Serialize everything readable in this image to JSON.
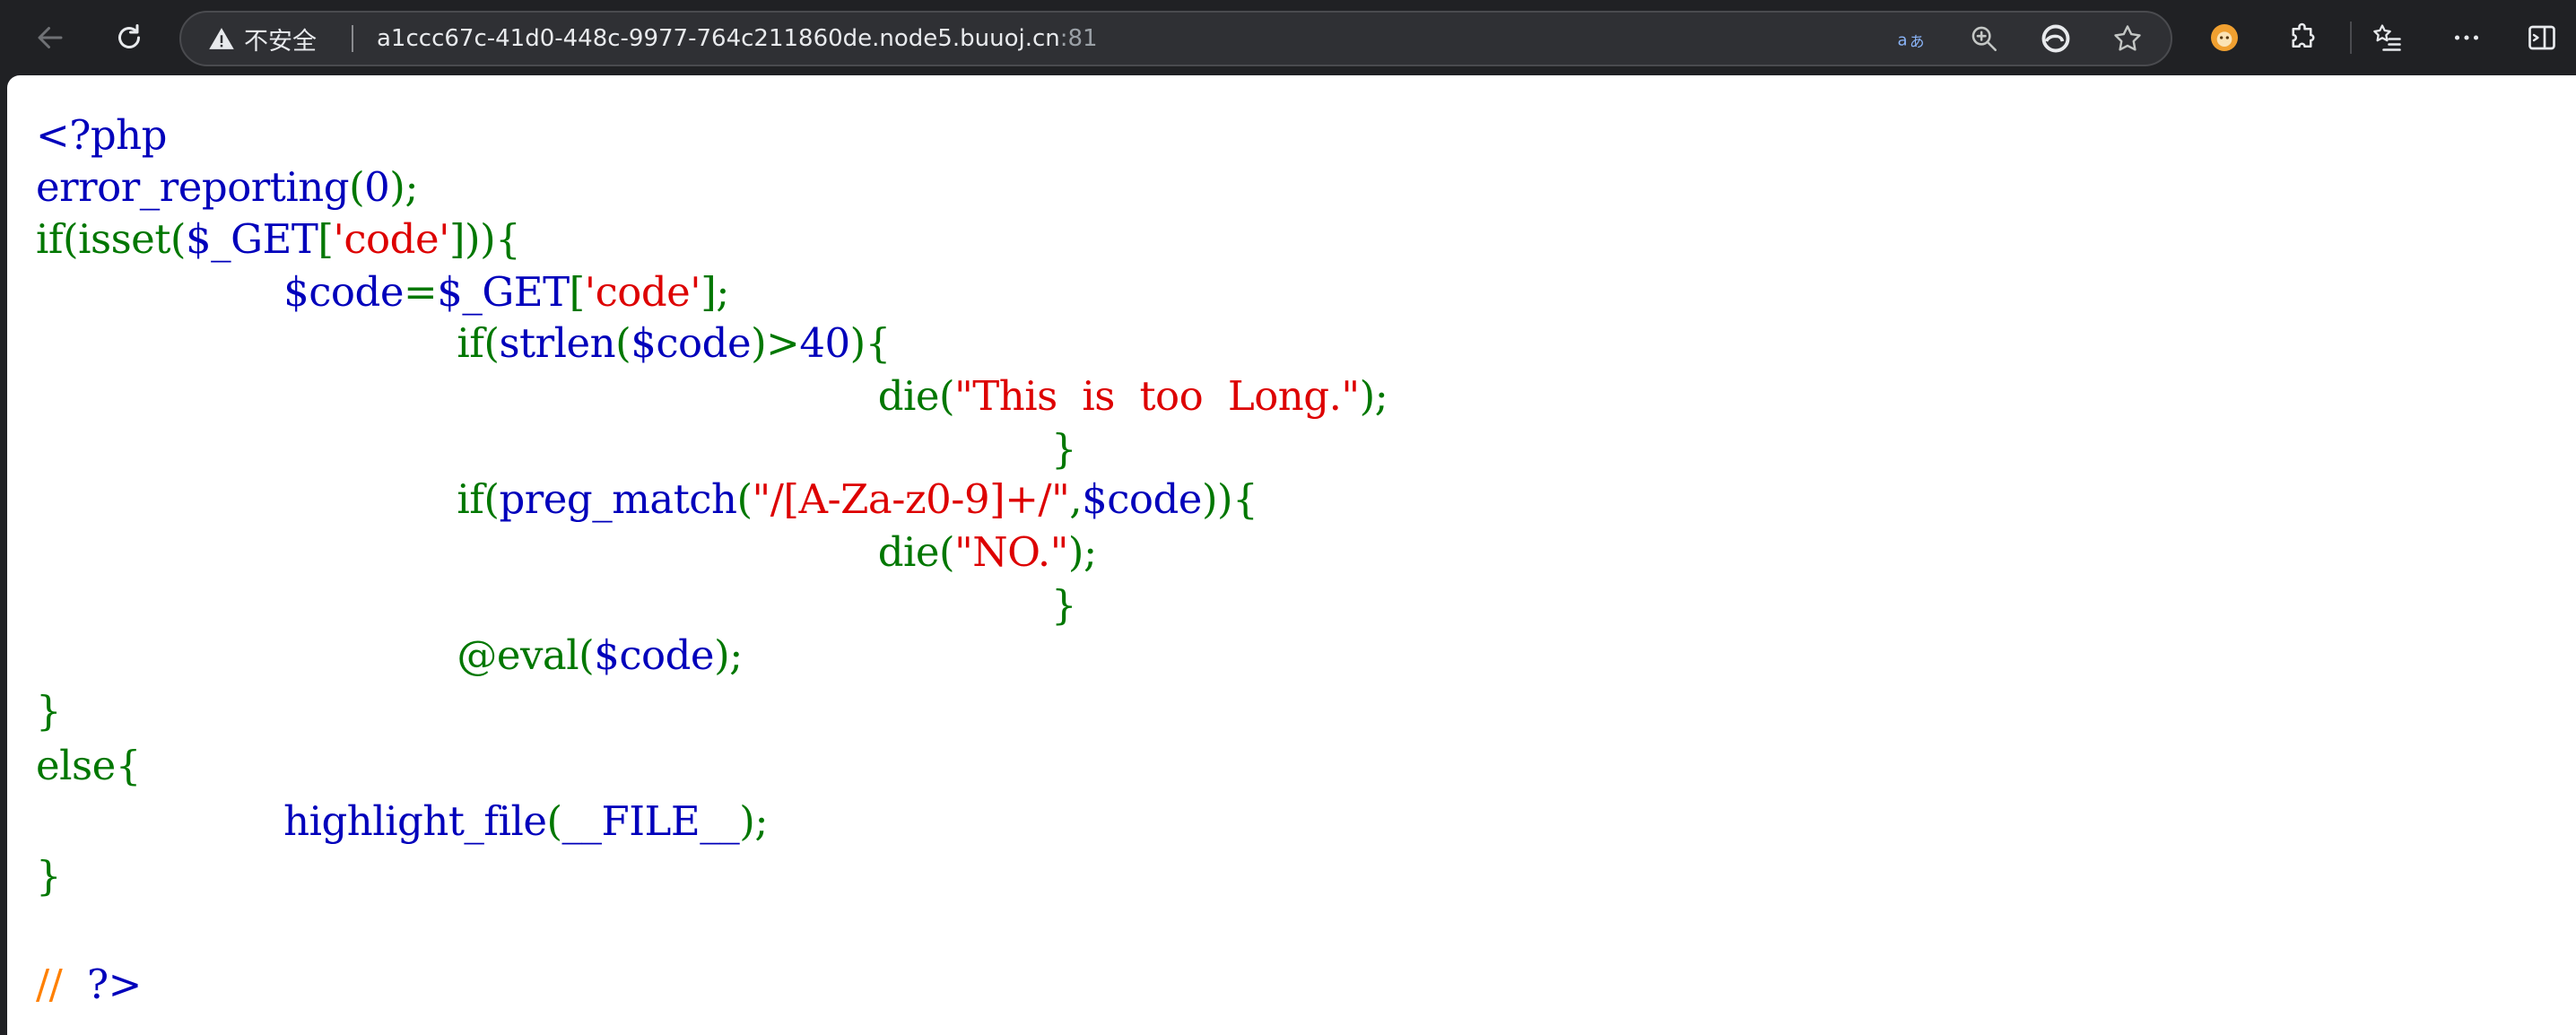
{
  "browser": {
    "security_label": "不安全",
    "url_host": "a1ccc67c-41d0-448c-9977-764c211860de.node5.buuoj.cn",
    "url_port": ":81",
    "toolbar_icons": [
      "back-arrow-icon",
      "reload-icon",
      "warning-triangle-icon",
      "read-aloud-icon",
      "zoom-icon",
      "edge-logo-icon",
      "favorite-star-icon",
      "extension-avatar-icon",
      "puzzle-extensions-icon",
      "favorites-list-icon",
      "more-dots-icon",
      "sidebar-toggle-icon"
    ]
  },
  "colors": {
    "php_default": "#0000bb",
    "php_keyword": "#007700",
    "php_string": "#dd0000",
    "php_comment": "#ff8000",
    "toolbar_bg": "#202124",
    "page_bg": "#ffffff"
  },
  "code": {
    "lines": [
      {
        "indent": "",
        "tokens": [
          {
            "t": "<?php",
            "c": "default"
          }
        ]
      },
      {
        "indent": "",
        "tokens": [
          {
            "t": "error_reporting",
            "c": "default"
          },
          {
            "t": "(",
            "c": "keyword"
          },
          {
            "t": "0",
            "c": "default"
          },
          {
            "t": ");",
            "c": "keyword"
          }
        ]
      },
      {
        "indent": "",
        "tokens": [
          {
            "t": "if(isset(",
            "c": "keyword"
          },
          {
            "t": "$_GET",
            "c": "default"
          },
          {
            "t": "[",
            "c": "keyword"
          },
          {
            "t": "'code'",
            "c": "string"
          },
          {
            "t": "])){",
            "c": "keyword"
          }
        ]
      },
      {
        "indent": "                    ",
        "tokens": [
          {
            "t": "$code",
            "c": "default"
          },
          {
            "t": "=",
            "c": "keyword"
          },
          {
            "t": "$_GET",
            "c": "default"
          },
          {
            "t": "[",
            "c": "keyword"
          },
          {
            "t": "'code'",
            "c": "string"
          },
          {
            "t": "];",
            "c": "keyword"
          }
        ]
      },
      {
        "indent": "                                  ",
        "tokens": [
          {
            "t": "if(",
            "c": "keyword"
          },
          {
            "t": "strlen",
            "c": "default"
          },
          {
            "t": "(",
            "c": "keyword"
          },
          {
            "t": "$code",
            "c": "default"
          },
          {
            "t": ")>",
            "c": "keyword"
          },
          {
            "t": "40",
            "c": "default"
          },
          {
            "t": "){",
            "c": "keyword"
          }
        ]
      },
      {
        "indent": "                                                                    ",
        "tokens": [
          {
            "t": "die(",
            "c": "keyword"
          },
          {
            "t": "\"This  is  too  Long.\"",
            "c": "string"
          },
          {
            "t": ");",
            "c": "keyword"
          }
        ]
      },
      {
        "indent": "                                                                                  ",
        "tokens": [
          {
            "t": "}",
            "c": "keyword"
          }
        ]
      },
      {
        "indent": "                                  ",
        "tokens": [
          {
            "t": "if(",
            "c": "keyword"
          },
          {
            "t": "preg_match",
            "c": "default"
          },
          {
            "t": "(",
            "c": "keyword"
          },
          {
            "t": "\"/[A-Za-z0-9]+/\"",
            "c": "string"
          },
          {
            "t": ",",
            "c": "keyword"
          },
          {
            "t": "$code",
            "c": "default"
          },
          {
            "t": ")){",
            "c": "keyword"
          }
        ]
      },
      {
        "indent": "                                                                    ",
        "tokens": [
          {
            "t": "die(",
            "c": "keyword"
          },
          {
            "t": "\"NO.\"",
            "c": "string"
          },
          {
            "t": ");",
            "c": "keyword"
          }
        ]
      },
      {
        "indent": "                                                                                  ",
        "tokens": [
          {
            "t": "}",
            "c": "keyword"
          }
        ]
      },
      {
        "indent": "                                  ",
        "tokens": [
          {
            "t": "@eval(",
            "c": "keyword"
          },
          {
            "t": "$code",
            "c": "default"
          },
          {
            "t": ");",
            "c": "keyword"
          }
        ]
      },
      {
        "indent": "",
        "tokens": [
          {
            "t": "}",
            "c": "keyword"
          }
        ]
      },
      {
        "indent": "",
        "tokens": [
          {
            "t": "else{",
            "c": "keyword"
          }
        ]
      },
      {
        "indent": "                    ",
        "tokens": [
          {
            "t": "highlight_file",
            "c": "default"
          },
          {
            "t": "(",
            "c": "keyword"
          },
          {
            "t": "__FILE__",
            "c": "default"
          },
          {
            "t": ");",
            "c": "keyword"
          }
        ]
      },
      {
        "indent": "",
        "tokens": [
          {
            "t": "}",
            "c": "keyword"
          }
        ]
      },
      {
        "indent": "",
        "tokens": []
      },
      {
        "indent": "",
        "tokens": [
          {
            "t": "//  ",
            "c": "comment"
          },
          {
            "t": "?>",
            "c": "default"
          }
        ]
      }
    ]
  }
}
